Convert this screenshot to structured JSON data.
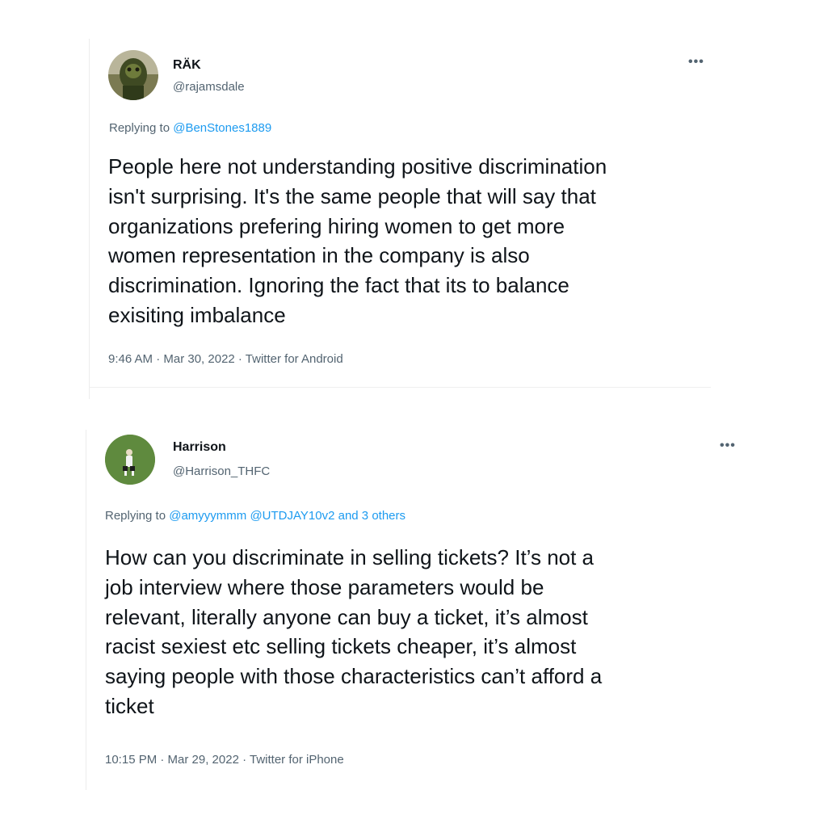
{
  "tweets": [
    {
      "name": "RÄK",
      "handle": "@rajamsdale",
      "more": "•••",
      "replying_prefix": "Replying to ",
      "replying_to": [
        "@BenStones1889"
      ],
      "replying_extra": "",
      "text": "People here not understanding positive discrimination\nisn't surprising. It's the same people that will say that\norganizations prefering hiring women to get more\nwomen representation in the company is also\ndiscrimination. Ignoring the fact that its to balance\nexisiting imbalance",
      "time": "9:46 AM · Mar 30, 2022 · Twitter for Android",
      "avatar_color": "#5e6a3a"
    },
    {
      "name": "Harrison",
      "handle": "@Harrison_THFC",
      "more": "•••",
      "replying_prefix": "Replying to ",
      "replying_to": [
        "@amyyymmm",
        "@UTDJAY10v2",
        "and 3 others"
      ],
      "replying_extra": "",
      "text": "How can you discriminate in selling tickets? It’s not a\njob interview where those parameters would be\nrelevant, literally anyone can buy a ticket, it’s almost\nracist sexiest etc selling tickets cheaper, it’s almost\nsaying people with those characteristics can’t afford a\nticket",
      "time": "10:15 PM · Mar 29, 2022 · Twitter for iPhone",
      "avatar_color": "#4f7a3b"
    }
  ]
}
